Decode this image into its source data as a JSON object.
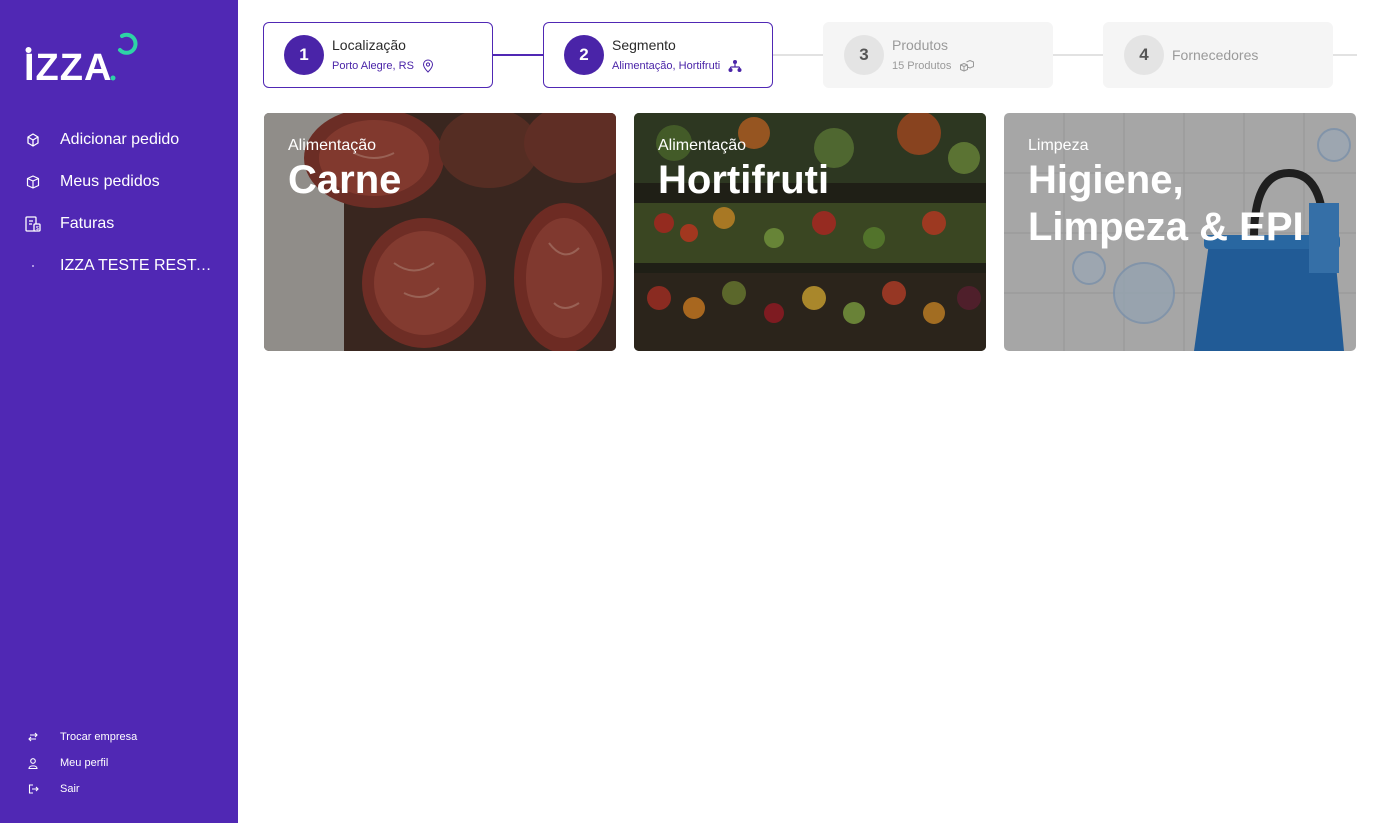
{
  "brand": {
    "logo_text": "IZZA",
    "primary_color": "#5028b4",
    "accent_color": "#2ed3a6"
  },
  "sidebar": {
    "items": [
      {
        "label": "Adicionar pedido",
        "icon": "add-order-icon"
      },
      {
        "label": "Meus pedidos",
        "icon": "box-icon"
      },
      {
        "label": "Faturas",
        "icon": "invoice-icon"
      },
      {
        "label": "IZZA TESTE RESTAURANTE",
        "icon": "dot-icon"
      }
    ],
    "bottom_items": [
      {
        "label": "Trocar empresa",
        "icon": "swap-icon"
      },
      {
        "label": "Meu perfil",
        "icon": "user-icon"
      },
      {
        "label": "Sair",
        "icon": "logout-icon"
      }
    ]
  },
  "stepper": {
    "steps": [
      {
        "number": "1",
        "title": "Localização",
        "subtitle": "Porto Alegre, RS",
        "icon": "location-pin-icon",
        "state": "completed"
      },
      {
        "number": "2",
        "title": "Segmento",
        "subtitle": "Alimentação, Hortifruti",
        "icon": "hierarchy-icon",
        "state": "current"
      },
      {
        "number": "3",
        "title": "Produtos",
        "subtitle": "15 Produtos",
        "icon": "products-icon",
        "state": "pending"
      },
      {
        "number": "4",
        "title": "Fornecedores",
        "subtitle": "",
        "icon": "",
        "state": "pending"
      }
    ]
  },
  "segments": [
    {
      "category": "Alimentação",
      "name": "Carne",
      "image": "raw-steaks-photo"
    },
    {
      "category": "Alimentação",
      "name": "Hortifruti",
      "image": "vegetable-market-photo"
    },
    {
      "category": "Limpeza",
      "name": "Higiene, Limpeza & EPI",
      "image": "cleaning-bucket-photo"
    }
  ]
}
